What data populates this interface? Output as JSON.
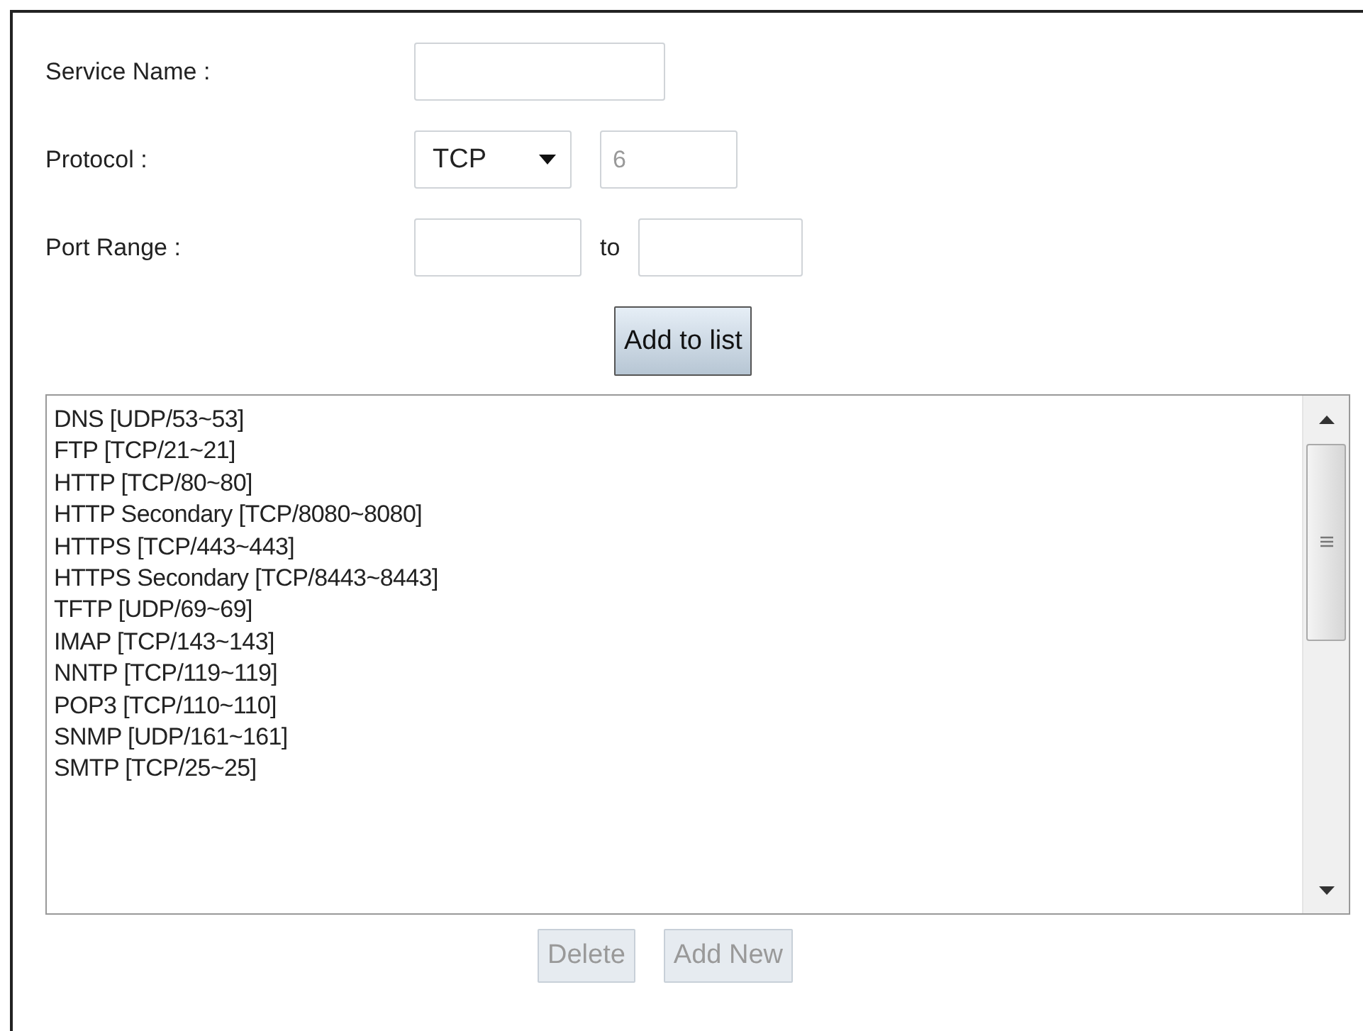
{
  "form": {
    "service_name": {
      "label": "Service Name :"
    },
    "protocol": {
      "label": "Protocol :",
      "value": "TCP",
      "number": "6",
      "number_disabled": true
    },
    "port_range": {
      "label": "Port Range :",
      "separator": "to"
    },
    "add_button": {
      "label": "Add to list",
      "disabled": false
    }
  },
  "services": [
    "DNS [UDP/53~53]",
    "FTP [TCP/21~21]",
    "HTTP [TCP/80~80]",
    "HTTP Secondary [TCP/8080~8080]",
    "HTTPS [TCP/443~443]",
    "HTTPS Secondary [TCP/8443~8443]",
    "TFTP [UDP/69~69]",
    "IMAP [TCP/143~143]",
    "NNTP [TCP/119~119]",
    "POP3 [TCP/110~110]",
    "SNMP [UDP/161~161]",
    "SMTP [TCP/25~25]"
  ],
  "buttons": [
    {
      "label": "Delete",
      "disabled": true
    },
    {
      "label": "Add New",
      "disabled": true
    }
  ]
}
